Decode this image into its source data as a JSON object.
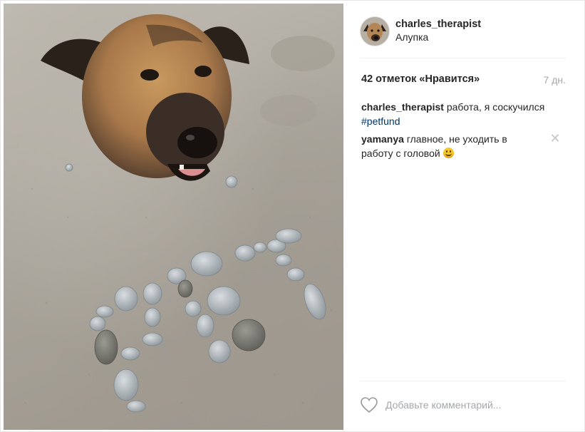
{
  "post": {
    "username": "charles_therapist",
    "location": "Алупка",
    "likes": "42 отметок «Нравится»",
    "time": "7 дн."
  },
  "comments": [
    {
      "user": "charles_therapist",
      "text": " работа, я соскучился ",
      "hashtag": "#petfund"
    },
    {
      "user": "yamanya",
      "text": " главное, не уходить в работу с головой ",
      "emoji": "smiling-face-emoji"
    }
  ],
  "comment_box": {
    "placeholder": "Добавьте комментарий..."
  },
  "icons": {
    "like": "heart-outline-icon",
    "delete": "close-icon"
  },
  "colors": {
    "text": "#262626",
    "muted": "#a5a7aa",
    "hashtag": "#003569",
    "divider": "#efefef"
  }
}
